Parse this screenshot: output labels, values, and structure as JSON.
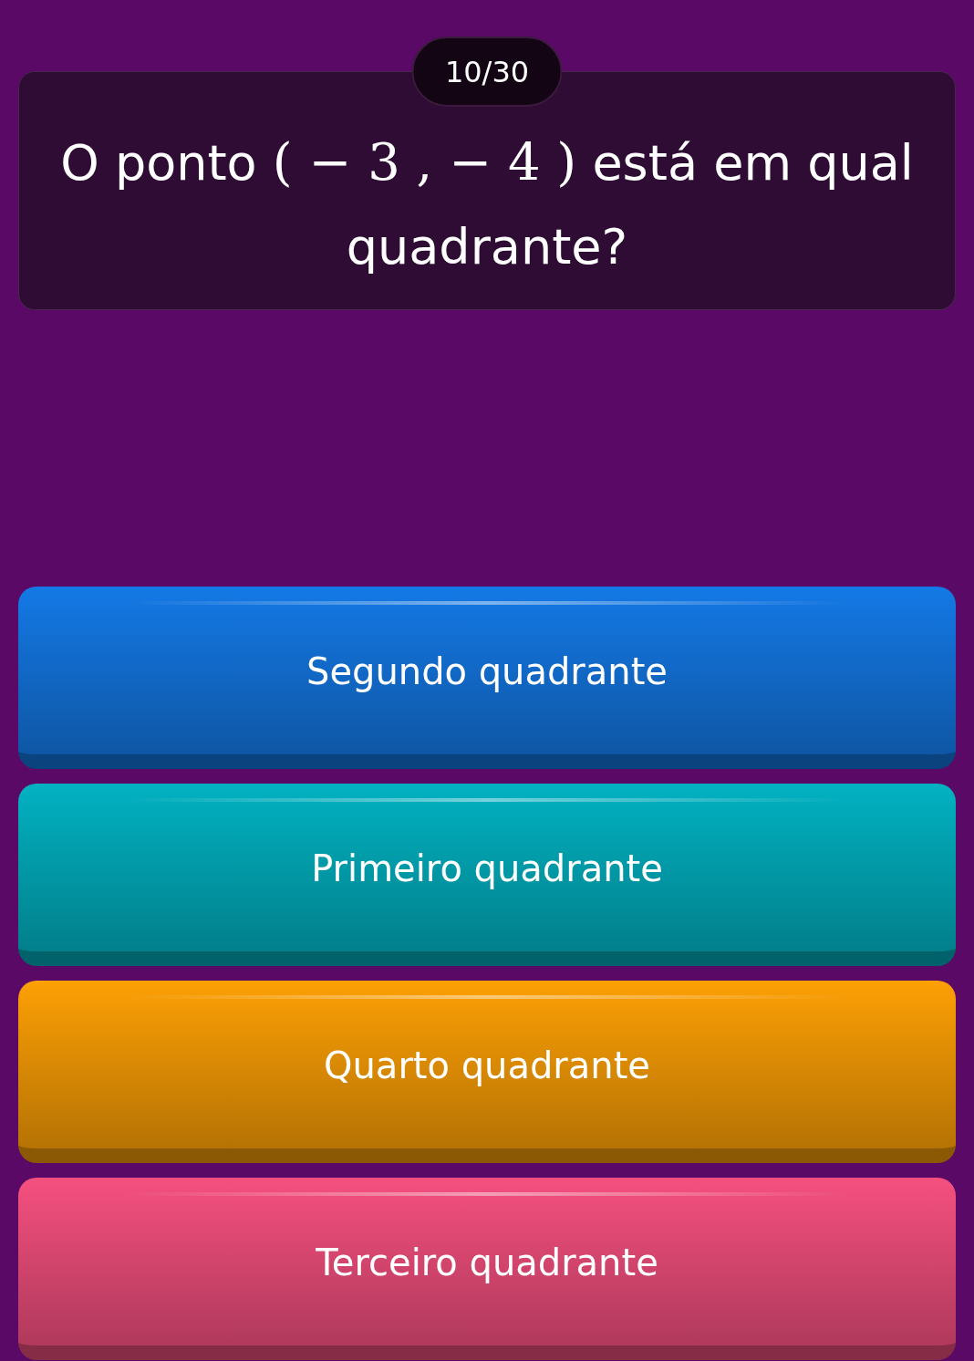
{
  "progress": {
    "counter": "10/30"
  },
  "question": {
    "text_before": "O ponto",
    "math": "( − 3 , − 4 )",
    "text_after": "está em qual quadrante?"
  },
  "options": [
    {
      "label": "Segundo quadrante",
      "color": "#1479e6"
    },
    {
      "label": "Primeiro quadrante",
      "color": "#02b2c2"
    },
    {
      "label": "Quarto quadrante",
      "color": "#fda005"
    },
    {
      "label": "Terceiro quadrante",
      "color": "#f5507f"
    }
  ]
}
